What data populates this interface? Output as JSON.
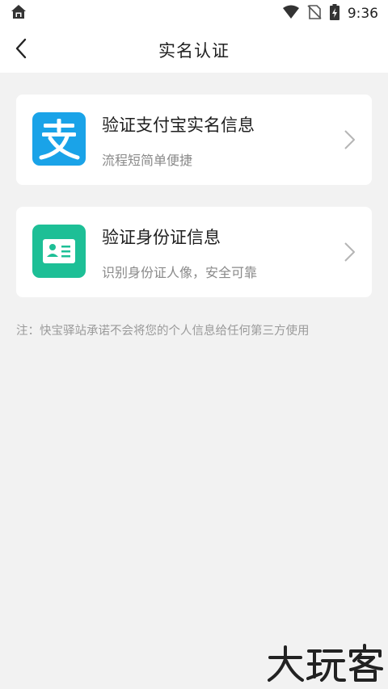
{
  "status_bar": {
    "time": "9:36",
    "home_icon": "home-icon",
    "wifi_icon": "wifi-icon",
    "signal_icon": "no-signal-icon",
    "battery_icon": "battery-charging-icon"
  },
  "header": {
    "title": "实名认证",
    "back_icon": "chevron-left-icon"
  },
  "options": [
    {
      "title": "验证支付宝实名信息",
      "subtitle": "流程短简单便捷",
      "icon": "alipay-icon",
      "icon_color": "#1aa3e8"
    },
    {
      "title": "验证身份证信息",
      "subtitle": "识别身份证人像，安全可靠",
      "icon": "id-card-icon",
      "icon_color": "#1dbf96"
    }
  ],
  "note": "注：快宝驿站承诺不会将您的个人信息给任何第三方使用",
  "watermark": "大玩客"
}
